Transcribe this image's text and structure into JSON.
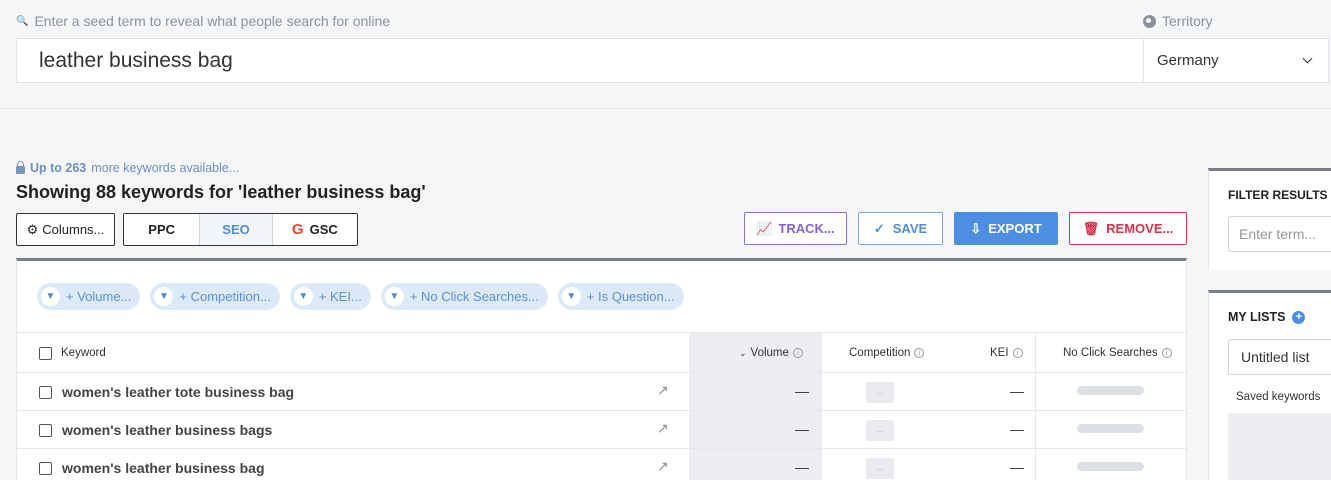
{
  "search": {
    "hint": "Enter a seed term to reveal what people search for online",
    "query": "leather business bag",
    "territory_label": "Territory",
    "territory_value": "Germany"
  },
  "summary": {
    "available_prefix": "Up to 263",
    "available_suffix": "more keywords available...",
    "showing": "Showing 88 keywords for 'leather business bag'"
  },
  "toolbar": {
    "columns": "Columns...",
    "tabs": [
      "PPC",
      "SEO",
      "GSC"
    ],
    "active_tab": "SEO",
    "track": "TRACK...",
    "save": "SAVE",
    "export": "EXPORT",
    "remove": "REMOVE..."
  },
  "filters": [
    "+ Volume...",
    "+ Competition...",
    "+ KEI...",
    "+ No Click Searches...",
    "+ Is Question..."
  ],
  "table": {
    "headers": {
      "keyword": "Keyword",
      "volume": "Volume",
      "competition": "Competition",
      "kei": "KEI",
      "no_click": "No Click Searches"
    },
    "rows": [
      {
        "keyword": "women's leather tote business bag",
        "volume": "—",
        "kei": "—"
      },
      {
        "keyword": "women's leather business bags",
        "volume": "—",
        "kei": "—"
      },
      {
        "keyword": "women's leather business bag",
        "volume": "—",
        "kei": "—"
      }
    ],
    "competition_placeholder": "–"
  },
  "side": {
    "filter_title": "FILTER RESULTS B",
    "filter_placeholder": "Enter term...",
    "lists_title": "MY LISTS",
    "list_selected": "Untitled list",
    "saved_label": "Saved keywords"
  },
  "colors": {
    "accent": "#4d8ee3",
    "track": "#8560d8",
    "remove": "#d9334b",
    "chip_bg": "#dce9f8"
  }
}
